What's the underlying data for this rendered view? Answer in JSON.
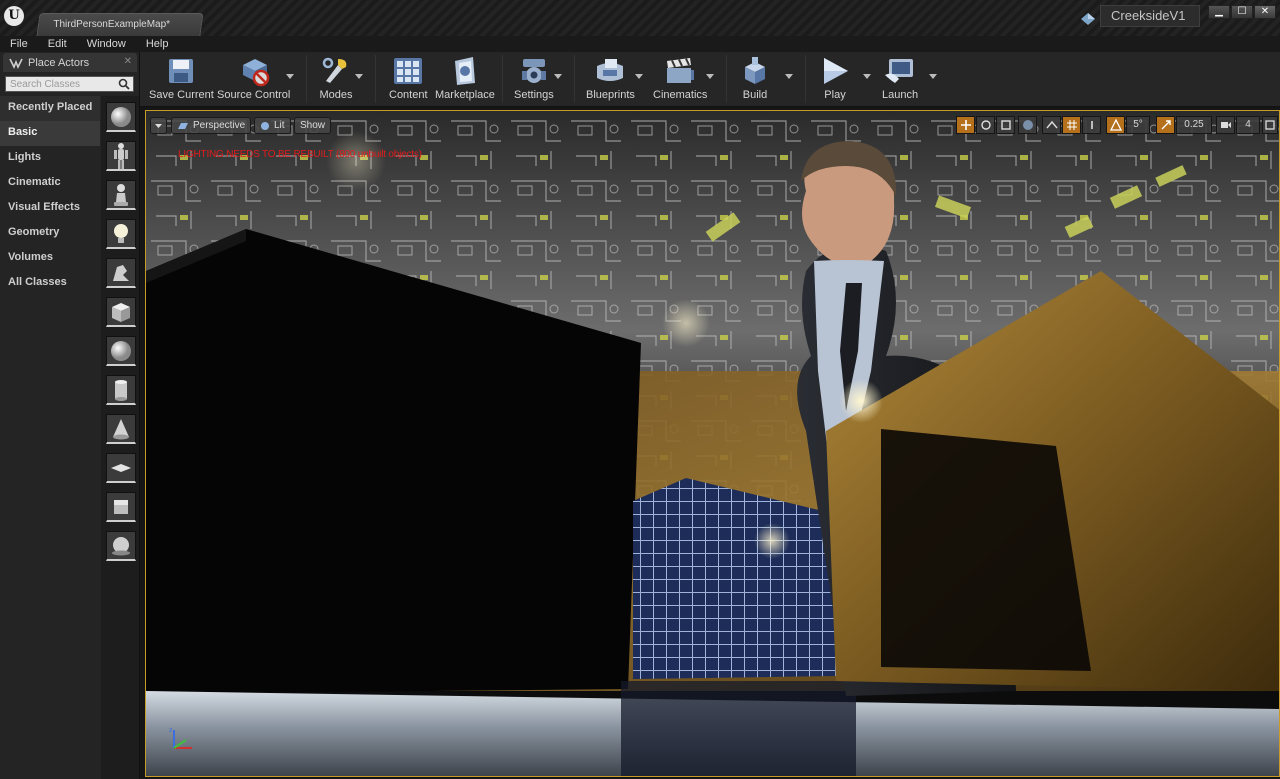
{
  "window": {
    "doc_tab": "ThirdPersonExampleMap*",
    "project_name": "CreeksideV1",
    "controls": {
      "minimize": "▁",
      "maximize": "☐",
      "close": "✕"
    }
  },
  "menu": [
    "File",
    "Edit",
    "Window",
    "Help"
  ],
  "place_actors": {
    "tab_label": "Place Actors",
    "search_placeholder": "Search Classes",
    "categories": [
      "Recently Placed",
      "Basic",
      "Lights",
      "Cinematic",
      "Visual Effects",
      "Geometry",
      "Volumes",
      "All Classes"
    ],
    "active_category": "Basic",
    "actor_icons": [
      "sphere-icon",
      "mannequin-icon",
      "pawn-icon",
      "point-light-icon",
      "player-start-icon",
      "cube-icon",
      "sphere-icon",
      "cylinder-icon",
      "cone-icon",
      "plane-icon",
      "box-trigger-icon",
      "sphere-trigger-icon"
    ]
  },
  "toolbar": {
    "save_current": "Save Current",
    "source_control": "Source Control",
    "modes": "Modes",
    "content": "Content",
    "marketplace": "Marketplace",
    "settings": "Settings",
    "blueprints": "Blueprints",
    "cinematics": "Cinematics",
    "build": "Build",
    "play": "Play",
    "launch": "Launch"
  },
  "viewport": {
    "perspective": "Perspective",
    "lit": "Lit",
    "show": "Show",
    "warning": "LIGHTING NEEDS TO BE REBUILT (800 unbuilt objects)",
    "rotation_snap": "5°",
    "scale_snap": "0.25",
    "camera_speed": "4"
  },
  "colors": {
    "accent_orange": "#b5701b",
    "viewport_border": "#c79a2a",
    "warning_red": "#e01c1c"
  }
}
